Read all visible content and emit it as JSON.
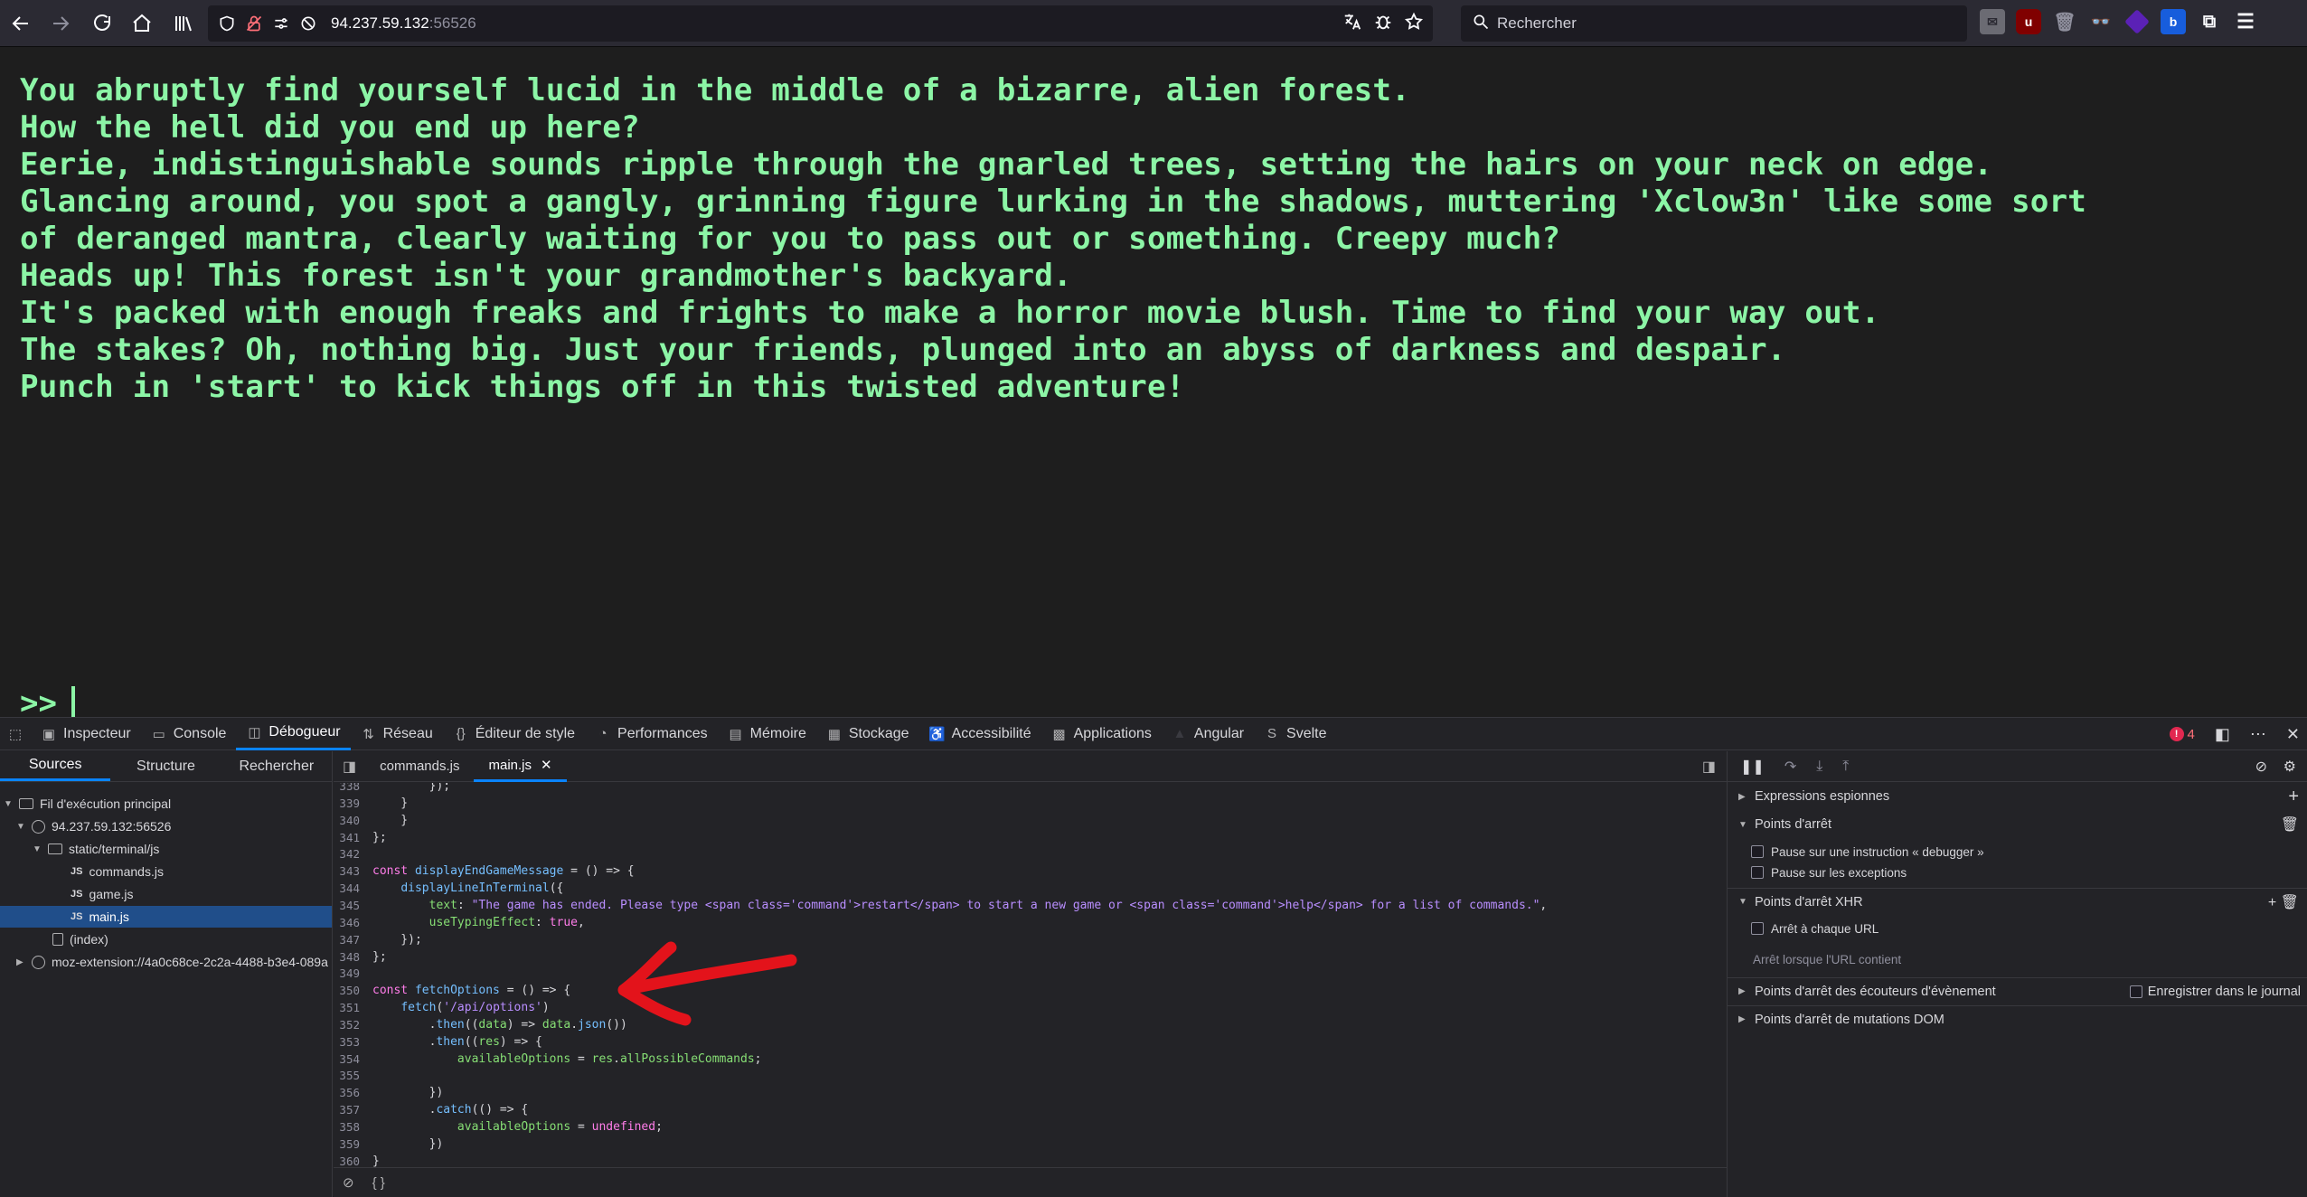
{
  "browser": {
    "url_host": "94.237.59.132",
    "url_port": ":56526",
    "search_placeholder": "Rechercher"
  },
  "terminal": {
    "lines": [
      "You abruptly find yourself lucid in the middle of a bizarre, alien forest.",
      "How the hell did you end up here?",
      "Eerie, indistinguishable sounds ripple through the gnarled trees, setting the hairs on your neck on edge.",
      "Glancing around, you spot a gangly, grinning figure lurking in the shadows, muttering 'Xclow3n' like some sort",
      "of deranged mantra, clearly waiting for you to pass out or something. Creepy much?",
      "Heads up! This forest isn't your grandmother's backyard.",
      "It's packed with enough freaks and frights to make a horror movie blush. Time to find your way out.",
      "The stakes? Oh, nothing big. Just your friends, plunged into an abyss of darkness and despair.",
      "Punch in 'start' to kick things off in this twisted adventure!"
    ],
    "prompt": ">>"
  },
  "devtools": {
    "tabs": [
      "Inspecteur",
      "Console",
      "Débogueur",
      "Réseau",
      "Éditeur de style",
      "Performances",
      "Mémoire",
      "Stockage",
      "Accessibilité",
      "Applications",
      "Angular",
      "Svelte"
    ],
    "active_tab": "Débogueur",
    "error_count": "4",
    "source_tabs": [
      "Sources",
      "Structure",
      "Rechercher"
    ],
    "tree": {
      "main_thread": "Fil d'exécution principal",
      "host": "94.237.59.132:56526",
      "folder": "static/terminal/js",
      "files": [
        "commands.js",
        "game.js",
        "main.js"
      ],
      "index": "(index)",
      "extension": "moz-extension://4a0c68ce-2c2a-4488-b3e4-089a"
    },
    "editor_tabs": [
      "commands.js",
      "main.js"
    ],
    "code": [
      {
        "n": "338",
        "html": "        });"
      },
      {
        "n": "339",
        "html": "    }"
      },
      {
        "n": "340",
        "html": "    }"
      },
      {
        "n": "341",
        "html": "};"
      },
      {
        "n": "342",
        "html": ""
      },
      {
        "n": "343",
        "html": "<span class='kw'>const</span> <span class='fn'>displayEndGameMessage</span> = () => {"
      },
      {
        "n": "344",
        "html": "    <span class='fn'>displayLineInTerminal</span>({"
      },
      {
        "n": "345",
        "html": "        <span class='id'>text</span>: <span class='str'>\"The game has ended. Please type &lt;span class='command'&gt;restart&lt;/span&gt; to start a new game or &lt;span class='command'&gt;help&lt;/span&gt; for a list of commands.\"</span>,"
      },
      {
        "n": "346",
        "html": "        <span class='id'>useTypingEffect</span>: <span class='kw'>true</span>,"
      },
      {
        "n": "347",
        "html": "    });"
      },
      {
        "n": "348",
        "html": "};"
      },
      {
        "n": "349",
        "html": ""
      },
      {
        "n": "350",
        "html": "<span class='kw'>const</span> <span class='fn'>fetchOptions</span> = () => {"
      },
      {
        "n": "351",
        "html": "    <span class='fn'>fetch</span>(<span class='str'>'/api/options'</span>)"
      },
      {
        "n": "352",
        "html": "        .<span class='fn'>then</span>((<span class='id'>data</span>) => <span class='id'>data</span>.<span class='fn'>json</span>())"
      },
      {
        "n": "353",
        "html": "        .<span class='fn'>then</span>((<span class='id'>res</span>) => {"
      },
      {
        "n": "354",
        "html": "            <span class='id'>availableOptions</span> = <span class='id'>res</span>.<span class='id'>allPossibleCommands</span>;"
      },
      {
        "n": "355",
        "html": ""
      },
      {
        "n": "356",
        "html": "        })"
      },
      {
        "n": "357",
        "html": "        .<span class='fn'>catch</span>(() => {"
      },
      {
        "n": "358",
        "html": "            <span class='id'>availableOptions</span> = <span class='kw'>undefined</span>;"
      },
      {
        "n": "359",
        "html": "        })"
      },
      {
        "n": "360",
        "html": "}"
      }
    ],
    "right_pane": {
      "watch": "Expressions espionnes",
      "breakpoints": "Points d'arrêt",
      "pause_debugger": "Pause sur une instruction « debugger »",
      "pause_exceptions": "Pause sur les exceptions",
      "xhr": "Points d'arrêt XHR",
      "every_url": "Arrêt à chaque URL",
      "url_contains": "Arrêt lorsque l'URL contient",
      "event_listeners": "Points d'arrêt des écouteurs d'évènement",
      "log": "Enregistrer dans le journal",
      "dom_mutations": "Points d'arrêt de mutations DOM"
    },
    "status_braces": "{ }"
  },
  "colors": {
    "terminal_text": "#8cf5a6",
    "accent": "#0a84ff",
    "annotation_arrow": "#e3131b"
  }
}
